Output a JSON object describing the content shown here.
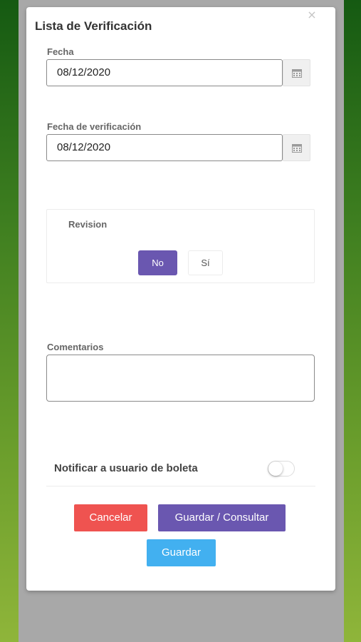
{
  "modal": {
    "title": "Lista de Verificación",
    "close_icon": "×"
  },
  "fecha": {
    "label": "Fecha",
    "value": "08/12/2020",
    "icon": "calendar-icon"
  },
  "fecha_verificacion": {
    "label": "Fecha de verificación",
    "value": "08/12/2020",
    "icon": "calendar-icon"
  },
  "revision": {
    "label": "Revision",
    "options": [
      "No",
      "Sí"
    ],
    "selected": "No"
  },
  "comentarios": {
    "label": "Comentarios",
    "value": ""
  },
  "notificar": {
    "label": "Notificar a usuario de boleta",
    "enabled": false
  },
  "actions": {
    "cancel": "Cancelar",
    "save_consult": "Guardar / Consultar",
    "save": "Guardar"
  },
  "colors": {
    "primary_purple": "#6a57b0",
    "cancel_red": "#ef5350",
    "save_blue": "#42b0f0"
  }
}
